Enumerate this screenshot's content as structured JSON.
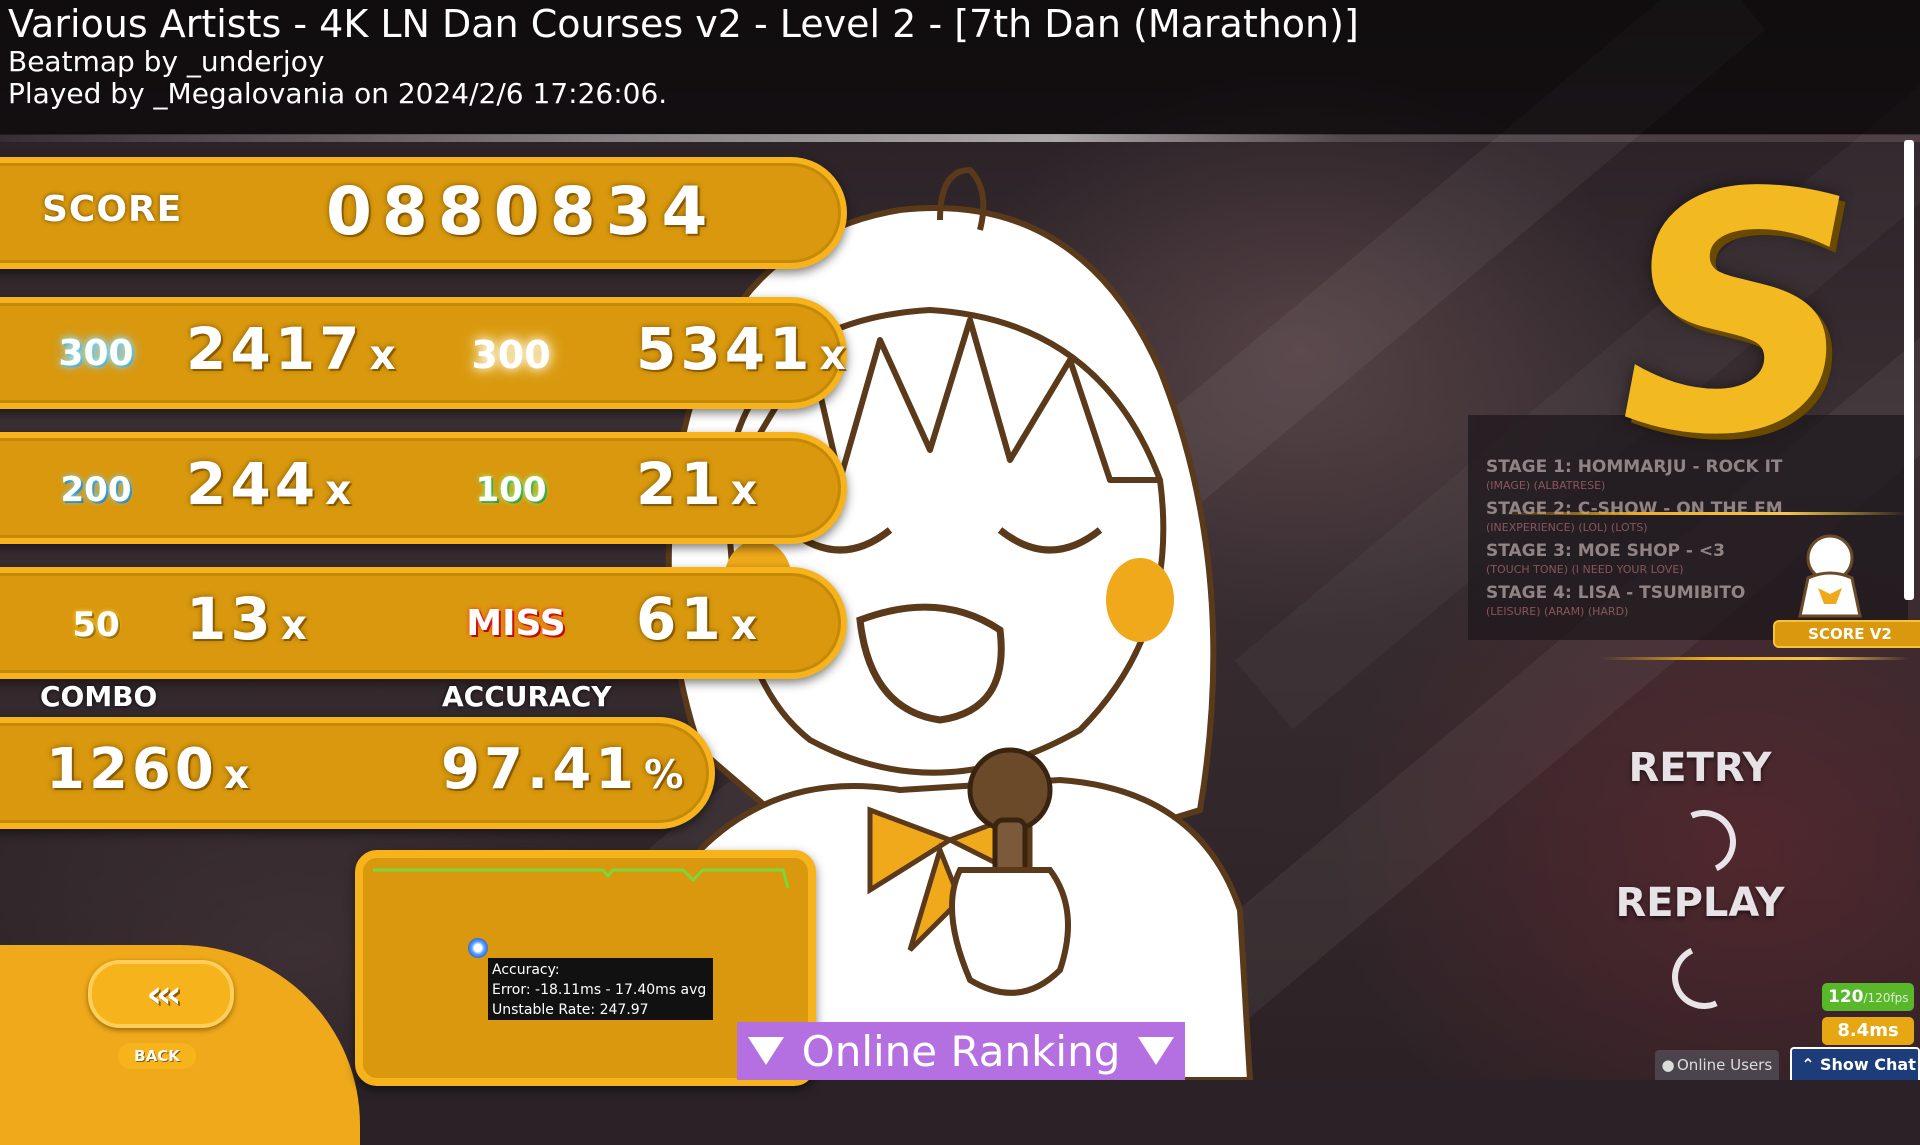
{
  "header": {
    "title": "Various Artists - 4K LN Dan Courses v2 - Level 2 - [7th Dan (Marathon)]",
    "beatmap_by": "Beatmap by _underjoy",
    "played_by": "Played by _Megalovania on 2024/2/6 17:26:06."
  },
  "score": {
    "label": "SCORE",
    "value": "0880834"
  },
  "judgements": {
    "j300": {
      "label": "300",
      "count": "2417",
      "suffix": "x"
    },
    "j300g": {
      "label": "300",
      "count": "5341",
      "suffix": "x"
    },
    "j200": {
      "label": "200",
      "count": "244",
      "suffix": "x"
    },
    "j100": {
      "label": "100",
      "count": "21",
      "suffix": "x"
    },
    "j50": {
      "label": "50",
      "count": "13",
      "suffix": "x"
    },
    "miss": {
      "label": "MISS",
      "count": "61",
      "suffix": "x"
    }
  },
  "combo": {
    "label": "COMBO",
    "value": "1260",
    "suffix": "x"
  },
  "accuracy": {
    "label": "ACCURACY",
    "value": "97.41",
    "suffix": "%"
  },
  "grade": "S",
  "course_card": {
    "stages": [
      {
        "name": "STAGE 1: HOMMARJU - ROCK IT",
        "sub": "(IMAGE) (ALBATRESE)"
      },
      {
        "name": "STAGE 2: C-SHOW - ON THE EM",
        "sub": "(INEXPERIENCE) (LOL) (LOTS)"
      },
      {
        "name": "STAGE 3: MOE SHOP - <3",
        "sub": "(TOUCH TONE) (I NEED YOUR LOVE)"
      },
      {
        "name": "STAGE 4: LISA - TSUMIBITO",
        "sub": "(LEISURE) (ARAM) (HARD)"
      }
    ],
    "mod_badge": "SCORE V2"
  },
  "buttons": {
    "retry": "RETRY",
    "replay": "REPLAY",
    "back": "BACK",
    "back_arrows": "‹‹‹",
    "online_ranking": "Online Ranking",
    "online_users": "Online Users",
    "show_chat": "Show Chat"
  },
  "tooltip": {
    "line1": "Accuracy:",
    "line2": "Error: -18.11ms - 17.40ms avg",
    "line3": "Unstable Rate: 247.97"
  },
  "perf": {
    "fps": "120",
    "fps_target": "/120fps",
    "latency": "8.4ms"
  },
  "colors": {
    "panel": "#d9980d",
    "panel_border": "#f7b31b",
    "grade": "#f2b920",
    "ranking": "#b46fe0",
    "fps": "#58b82a"
  }
}
